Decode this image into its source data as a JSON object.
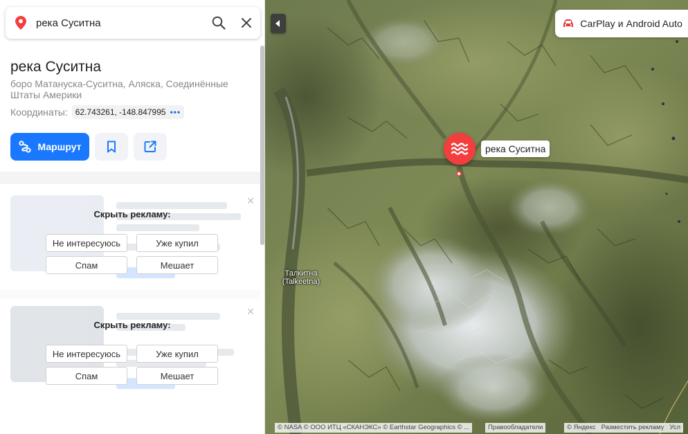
{
  "search": {
    "value": "река Суситна",
    "placeholder": ""
  },
  "place": {
    "title": "река Суситна",
    "address": "боро Матануска-Суситна, Аляска, Соединённые Штаты Америки",
    "coords_label": "Координаты:",
    "coords_value": "62.743261, -148.847995",
    "coords_more": "•••"
  },
  "actions": {
    "route_label": "Маршрут"
  },
  "ads": [
    {
      "heading": "Скрыть рекламу:",
      "options": [
        "Не интересуюсь",
        "Уже купил",
        "Спам",
        "Мешает"
      ]
    },
    {
      "heading": "Скрыть рекламу:",
      "options": [
        "Не интересуюсь",
        "Уже купил",
        "Спам",
        "Мешает"
      ]
    }
  ],
  "map": {
    "carplay_label": "CarPlay и Android Auto",
    "pin_label": "река Суситна",
    "place_label": "Талкитна (Talkeetna)",
    "attribution": "© NASA © ООО ИТЦ «СКАНЭКС» © Earthstar Geographics © ...",
    "attribution_link": "Правообладатели",
    "yandex": "© Яндекс",
    "place_ad": "Разместить рекламу",
    "terms": "Усл"
  },
  "colors": {
    "accent": "#1a78ff",
    "pin": "#f43e3e"
  },
  "icons": {
    "search_pin": "location-pin-icon",
    "search": "search-icon",
    "close": "close-icon",
    "route": "route-icon",
    "bookmark": "bookmark-icon",
    "share": "share-icon",
    "car": "car-icon",
    "collapse": "chevron-left-icon",
    "river": "water-waves-icon"
  }
}
